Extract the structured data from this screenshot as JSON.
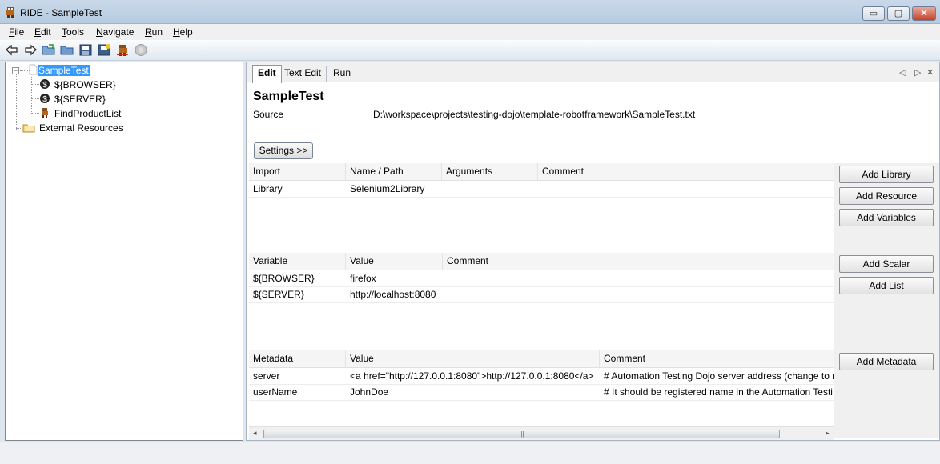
{
  "window": {
    "title": "RIDE - SampleTest",
    "min_label": "▭",
    "max_label": "▢",
    "close_label": "✕"
  },
  "menu": [
    {
      "label": "File",
      "key": "F"
    },
    {
      "label": "Edit",
      "key": "E"
    },
    {
      "label": "Tools",
      "key": "T"
    },
    {
      "label": "Navigate",
      "key": "N"
    },
    {
      "label": "Run",
      "key": "R"
    },
    {
      "label": "Help",
      "key": "H"
    }
  ],
  "toolbar": [
    "back-arrow-icon",
    "forward-arrow-icon",
    "open-folder-icon",
    "open-directory-icon",
    "save-icon",
    "save-all-icon",
    "robot-icon",
    "stop-icon"
  ],
  "tree": {
    "root": "SampleTest",
    "expander": "−",
    "items": [
      "${BROWSER}",
      "${SERVER}",
      "FindProductList",
      "External Resources"
    ]
  },
  "tabs": [
    "Edit",
    "Text Edit",
    "Run"
  ],
  "tab_controls": {
    "prev": "◁",
    "next": "▷",
    "close": "✕"
  },
  "suite": {
    "name": "SampleTest",
    "source_label": "Source",
    "source_value": "D:\\workspace\\projects\\testing-dojo\\template-robotframework\\SampleTest.txt",
    "settings_button": "Settings >>"
  },
  "imports": {
    "headers": [
      "Import",
      "Name / Path",
      "Arguments",
      "Comment"
    ],
    "rows": [
      [
        "Library",
        "Selenium2Library",
        "",
        ""
      ]
    ],
    "buttons": [
      "Add Library",
      "Add Resource",
      "Add Variables"
    ]
  },
  "variables": {
    "headers": [
      "Variable",
      "Value",
      "Comment"
    ],
    "rows": [
      [
        "${BROWSER}",
        "firefox",
        ""
      ],
      [
        "${SERVER}",
        "http://localhost:8080",
        ""
      ]
    ],
    "buttons": [
      "Add Scalar",
      "Add List"
    ]
  },
  "metadata": {
    "headers": [
      "Metadata",
      "Value",
      "Comment"
    ],
    "rows": [
      [
        "server",
        "<a href=\"http://127.0.0.1:8080\">http://127.0.0.1:8080</a>",
        "# Automation Testing Dojo server address (change to r"
      ],
      [
        "userName",
        "JohnDoe",
        "# It should be registered name in the Automation Testi"
      ]
    ],
    "buttons": [
      "Add Metadata"
    ]
  },
  "scrollbar": {
    "grip": "|||",
    "left_arrow": "◂",
    "right_arrow": "▸"
  }
}
